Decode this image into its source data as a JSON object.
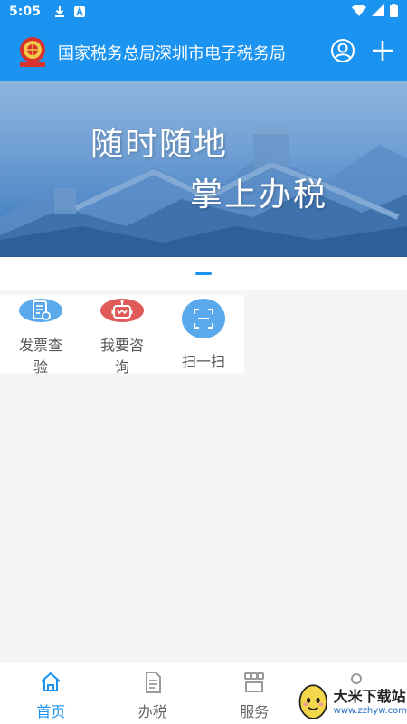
{
  "status_bar": {
    "time": "5:05",
    "left_icons": [
      "download-icon",
      "app-a-icon"
    ],
    "right_icons": [
      "wifi-icon",
      "signal-icon",
      "battery-icon"
    ]
  },
  "header": {
    "title": "国家税务总局深圳市电子税务局",
    "background": "#1b93f0",
    "emblem_icon": "tax-emblem-icon",
    "actions": [
      "user-icon",
      "plus-icon"
    ]
  },
  "banner": {
    "line1": "随时随地",
    "line2": "掌上办税",
    "active_slide": 1
  },
  "quick_actions": [
    {
      "label": "发票查验",
      "icon": "invoice-check-icon",
      "color": "#5aa9ec"
    },
    {
      "label": "我要咨询",
      "icon": "robot-icon",
      "color": "#e05a5a"
    },
    {
      "label": "扫一扫",
      "icon": "scan-icon",
      "color": "#5aa9ec"
    }
  ],
  "tab_bar": {
    "active_color": "#1b93f0",
    "tabs": [
      {
        "label": "首页",
        "icon": "home-icon",
        "active": true
      },
      {
        "label": "办税",
        "icon": "document-icon",
        "active": false
      },
      {
        "label": "服务",
        "icon": "service-icon",
        "active": false
      },
      {
        "label": "",
        "icon": "profile-icon",
        "active": false
      }
    ]
  },
  "watermark": {
    "name": "大米下载站",
    "url": "www.zzhyw.com"
  }
}
